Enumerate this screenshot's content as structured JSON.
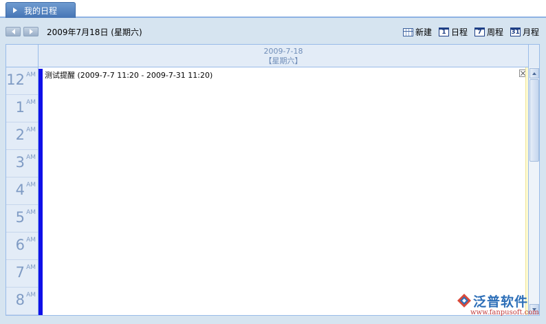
{
  "tab": {
    "label": "我的日程"
  },
  "toolbar": {
    "current_date": "2009年7月18日 (星期六)",
    "actions": [
      {
        "label": "新建",
        "icon": "calendar-grid-icon"
      },
      {
        "label": "日程",
        "icon_text": "1"
      },
      {
        "label": "周程",
        "icon_text": "7"
      },
      {
        "label": "月程",
        "icon_text": "31"
      }
    ]
  },
  "day_header": {
    "date": "2009-7-18",
    "weekday": "【星期六】"
  },
  "hours": [
    {
      "num": "12",
      "ampm": "AM"
    },
    {
      "num": "1",
      "ampm": "AM"
    },
    {
      "num": "2",
      "ampm": "AM"
    },
    {
      "num": "3",
      "ampm": "AM"
    },
    {
      "num": "4",
      "ampm": "AM"
    },
    {
      "num": "5",
      "ampm": "AM"
    },
    {
      "num": "6",
      "ampm": "AM"
    },
    {
      "num": "7",
      "ampm": "AM"
    },
    {
      "num": "8",
      "ampm": "AM"
    }
  ],
  "event": {
    "title": "测试提醒",
    "range": "(2009-7-7 11:20 - 2009-7-31 11:20)"
  },
  "watermark": {
    "title": "泛普软件",
    "url": "www.fanpusoft.com"
  },
  "colors": {
    "event_bar": "#1010e8",
    "hour_text": "#7f9bc4",
    "header_bg": "#e3ecf7",
    "tab": "#4675b5"
  }
}
